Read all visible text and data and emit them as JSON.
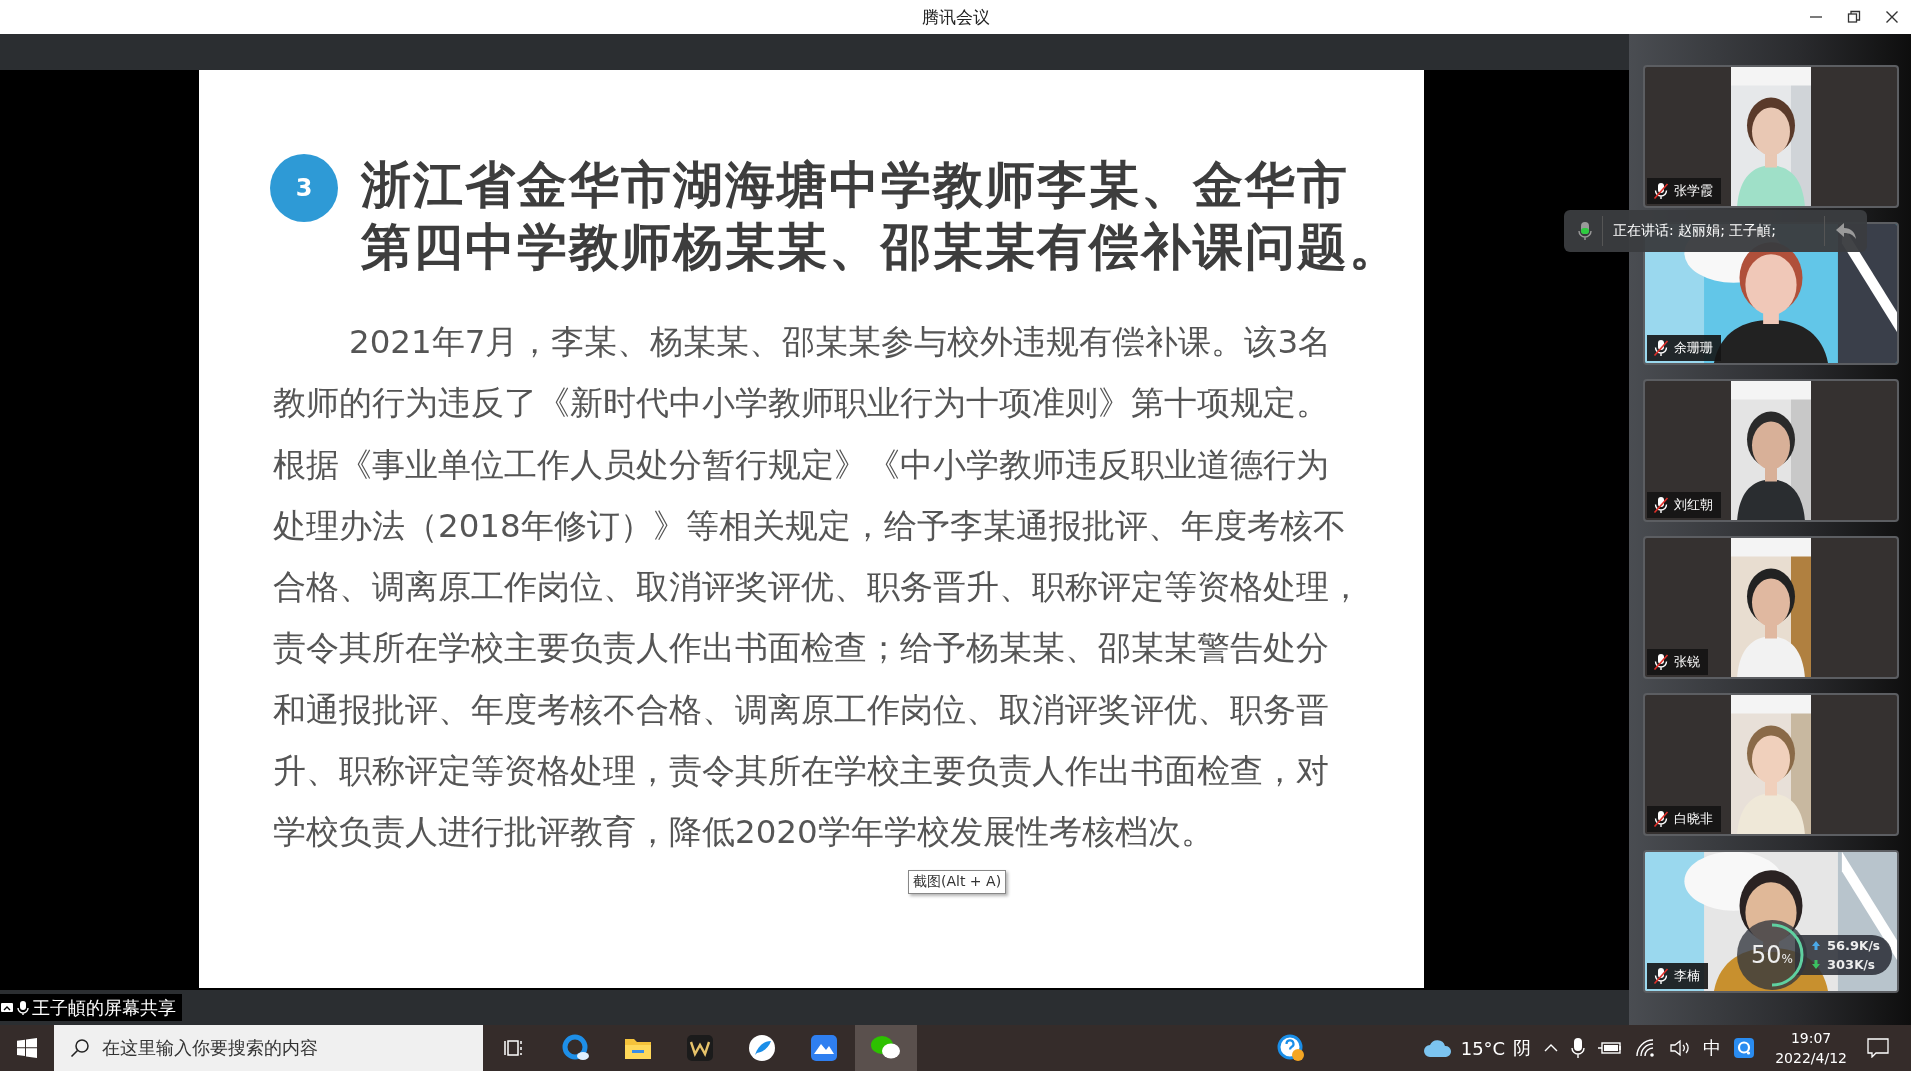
{
  "window": {
    "title": "腾讯会议"
  },
  "slide": {
    "number": "3",
    "title_lines": [
      "浙江省金华市湖海塘中学教师李某、金华市",
      "第四中学教师杨某某、邵某某有偿补课问题。"
    ],
    "body_lines": [
      "2021年7月，李某、杨某某、邵某某参与校外违规有偿补课。该3名",
      "教师的行为违反了《新时代中小学教师职业行为十项准则》第十项规定。",
      "根据《事业单位工作人员处分暂行规定》《中小学教师违反职业道德行为",
      "处理办法（2018年修订）》等相关规定，给予李某通报批评、年度考核不",
      "合格、调离原工作岗位、取消评奖评优、职务晋升、职称评定等资格处理，",
      "责令其所在学校主要负责人作出书面检查；给予杨某某、邵某某警告处分",
      "和通报批评、年度考核不合格、调离原工作岗位、取消评奖评优、职务晋",
      "升、职称评定等资格处理，责令其所在学校主要负责人作出书面检查，对",
      "学校负责人进行批评教育，降低2020学年学校发展性考核档次。"
    ]
  },
  "tooltip": "截图(Alt + A)",
  "share_label": "王子頔的屏幕共享",
  "speaking": "正在讲话: 赵丽娟; 王子頔;",
  "participants": [
    {
      "name": "张学霞",
      "muted": true,
      "kind": "portrait"
    },
    {
      "name": "余珊珊",
      "muted": true,
      "kind": "wide"
    },
    {
      "name": "刘红朝",
      "muted": true,
      "kind": "portrait"
    },
    {
      "name": "张锐",
      "muted": true,
      "kind": "portrait"
    },
    {
      "name": "白晓非",
      "muted": true,
      "kind": "portrait"
    },
    {
      "name": "李楠",
      "muted": true,
      "kind": "wide"
    }
  ],
  "network": {
    "value": "50",
    "unit": "%",
    "level": 0.5,
    "upload": "56.9",
    "upload_unit": "K/s",
    "download": "303",
    "download_unit": "K/s"
  },
  "taskbar": {
    "search": {
      "placeholder": "在这里输入你要搜索的内容"
    },
    "apps": [
      {
        "kind": "taskview",
        "selected": false
      },
      {
        "kind": "browser",
        "selected": false
      },
      {
        "kind": "folder",
        "selected": false
      },
      {
        "kind": "office",
        "selected": false
      },
      {
        "kind": "feather",
        "selected": false
      },
      {
        "kind": "mountain",
        "selected": false
      },
      {
        "kind": "chat",
        "selected": true
      }
    ]
  },
  "tray": {
    "temperature": "15°C",
    "weather": "阴",
    "ime": "中",
    "time": "19:07",
    "date": "2022/4/12"
  }
}
